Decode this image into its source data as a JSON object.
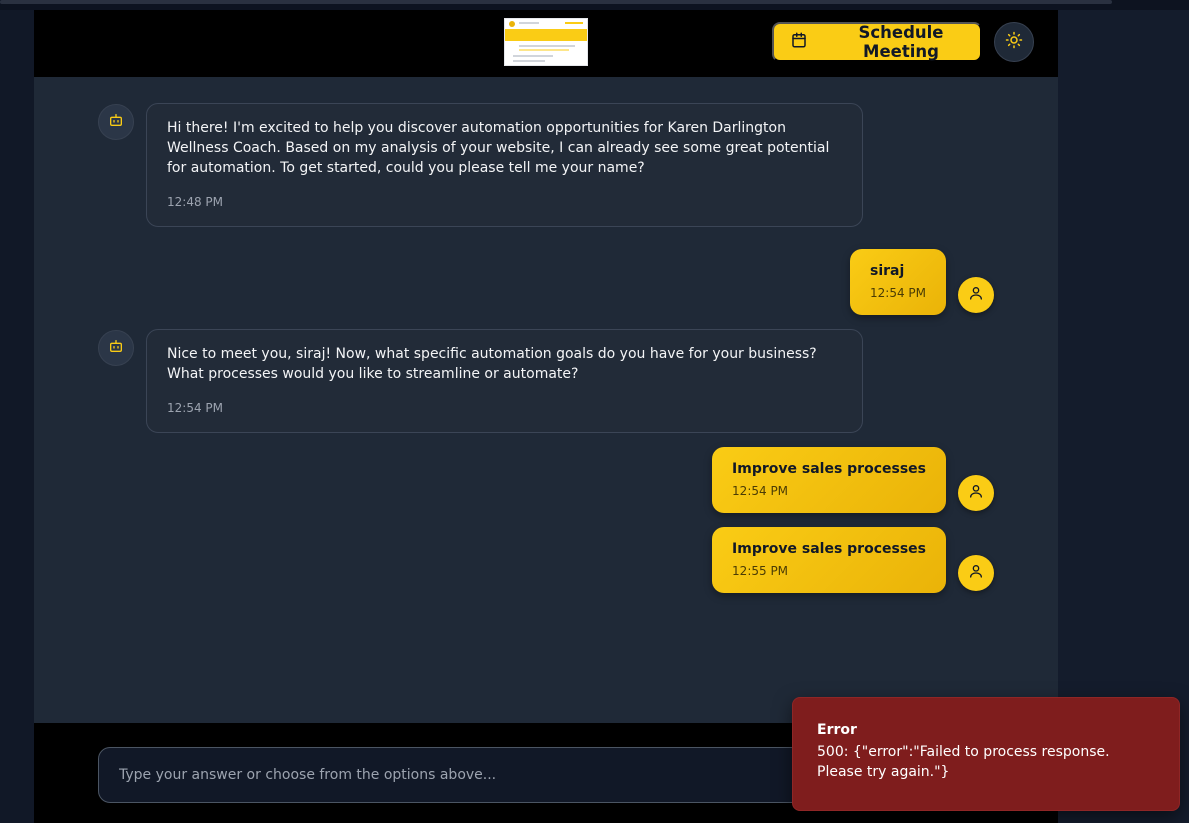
{
  "header": {
    "schedule_button_label": "Schedule Meeting",
    "theme_toggle_icon": "sun-icon",
    "schedule_icon": "calendar-icon"
  },
  "messages": [
    {
      "role": "bot",
      "text": "Hi there! I'm excited to help you discover automation opportunities for Karen Darlington Wellness Coach. Based on my analysis of your website, I can already see some great potential for automation. To get started, could you please tell me your name?",
      "time": "12:48 PM"
    },
    {
      "role": "user",
      "text": "siraj",
      "time": "12:54 PM"
    },
    {
      "role": "bot",
      "text": "Nice to meet you, siraj! Now, what specific automation goals do you have for your business? What processes would you like to streamline or automate?",
      "time": "12:54 PM"
    },
    {
      "role": "user",
      "text": "Improve sales processes",
      "time": "12:54 PM"
    },
    {
      "role": "user",
      "text": "Improve sales processes",
      "time": "12:55 PM"
    }
  ],
  "input": {
    "placeholder": "Type your answer or choose from the options above..."
  },
  "toast": {
    "title": "Error",
    "message": "500: {\"error\":\"Failed to process response. Please try again.\"}"
  },
  "colors": {
    "accent": "#facc15",
    "error": "#7f1d1d",
    "background": "#1f2937"
  }
}
